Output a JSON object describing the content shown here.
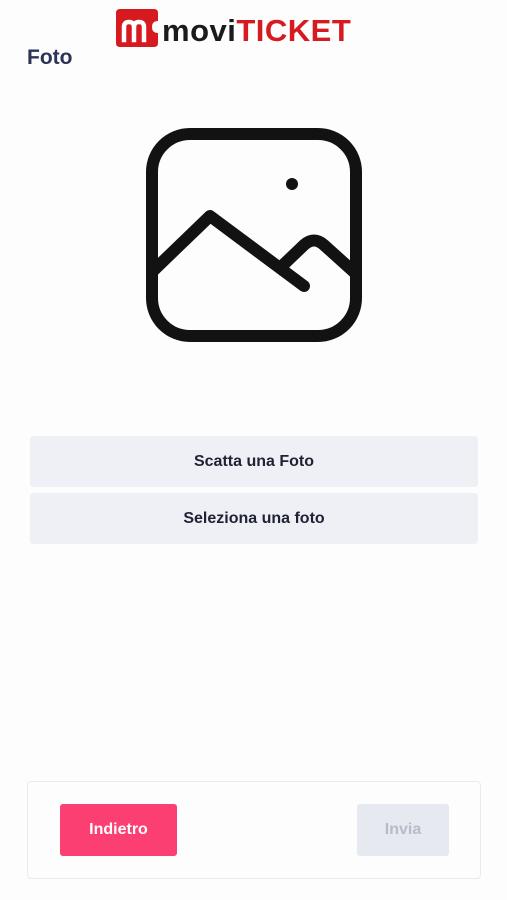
{
  "header": {
    "logo": {
      "text_part1": "movi",
      "text_part2": "TICKET"
    },
    "title": "Foto"
  },
  "main": {
    "placeholder_icon": "image-icon",
    "actions": {
      "take_photo_label": "Scatta una Foto",
      "select_photo_label": "Seleziona una foto"
    }
  },
  "footer": {
    "back_label": "Indietro",
    "send_label": "Invia",
    "send_disabled": true
  },
  "colors": {
    "brand_red": "#d71920",
    "accent_pink": "#fb3f72",
    "title_navy": "#2c3354",
    "button_bg": "#eef0f6",
    "disabled_bg": "#e6e9ef",
    "disabled_text": "#b6bcc8"
  }
}
